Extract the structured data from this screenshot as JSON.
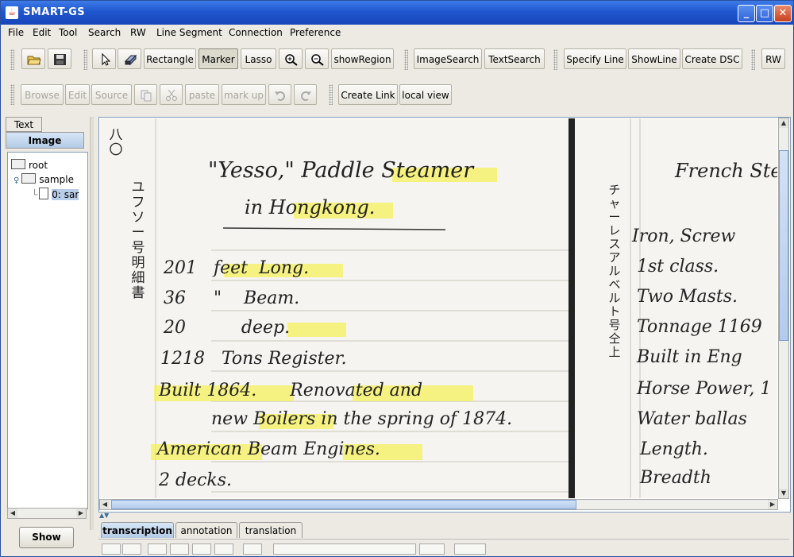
{
  "window": {
    "title": "SMART-GS",
    "controls": [
      "minimize",
      "maximize",
      "close"
    ]
  },
  "menubar": [
    "File",
    "Edit",
    "Tool",
    "Search",
    "RW",
    "Line Segment",
    "Connection",
    "Preference"
  ],
  "toolbar1": {
    "open_icon": "folder-open-icon",
    "save_icon": "floppy-disk-icon",
    "select_icon": "arrow-pointer-icon",
    "eraser_icon": "eraser-icon",
    "rectangle": "Rectangle",
    "marker": "Marker",
    "lasso": "Lasso",
    "zoom_in_icon": "zoom-in-icon",
    "zoom_out_icon": "zoom-out-icon",
    "show_region": "showRegion",
    "image_search": "ImageSearch",
    "text_search": "TextSearch",
    "specify_line": "Specify Line",
    "show_line": "ShowLine",
    "create_dsc": "Create DSC",
    "rw": "RW"
  },
  "toolbar2": {
    "browse": "Browse",
    "edit": "Edit",
    "source": "Source",
    "copy_icon": "copy-icon",
    "cut_icon": "scissors-icon",
    "paste": "paste",
    "mark_up": "mark up",
    "undo_icon": "undo-icon",
    "redo_icon": "redo-icon",
    "create_link": "Create Link",
    "local_view": "local view"
  },
  "left_panel": {
    "tabs": [
      "Text",
      "Image"
    ],
    "selected_tab": "Image",
    "tree": {
      "root": "root",
      "folder": "sample",
      "file": "0: sar"
    },
    "show_button": "Show"
  },
  "document": {
    "page_number": "八〇",
    "japanese_title": "ユフソー号明細書",
    "japanese_right": "チャーレスアルベルト号仝上",
    "lines": [
      "\"Yesso,\" Paddle Steamer",
      "in Hongkong.",
      "201   feet  Long.",
      "36     \"    Beam.",
      "20          deep.",
      "1218   Tons Register.",
      "Built 1864.      Renovated and",
      "new Boilers in the spring of 1874.",
      "American Beam Engines.",
      "2 decks."
    ],
    "right_lines": [
      "French Ste",
      "Iron, Screw",
      "1st class.",
      "Two Masts.",
      "Tonnage 1169",
      "Built in Eng",
      "Horse Power, 1",
      "Water ballas",
      "Length.",
      "Breadth"
    ],
    "highlight_color": "#f6f25c"
  },
  "bottom_tabs": [
    "transcription",
    "annotation",
    "translation"
  ],
  "bottom_selected": "transcription"
}
